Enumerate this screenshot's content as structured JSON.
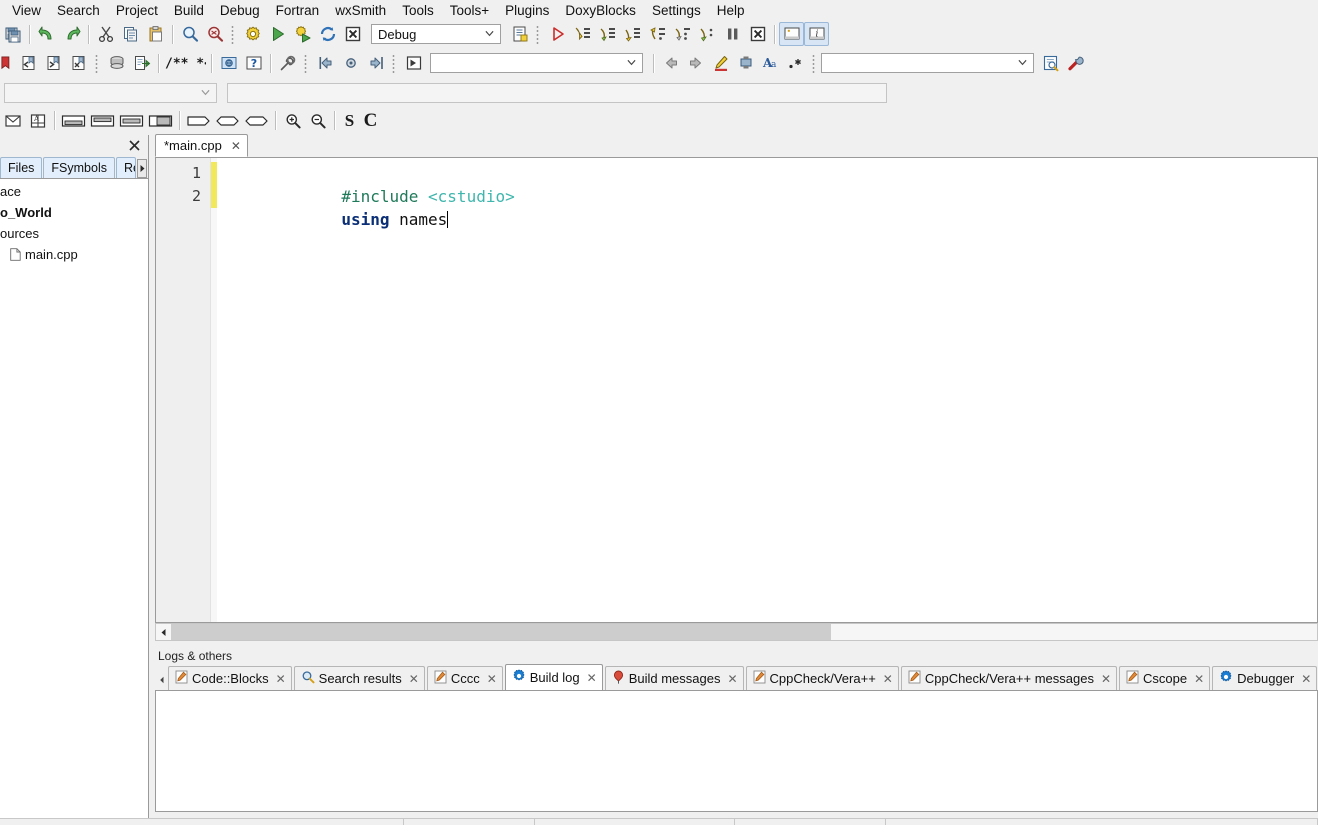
{
  "menu": {
    "items": [
      "View",
      "Search",
      "Project",
      "Build",
      "Debug",
      "Fortran",
      "wxSmith",
      "Tools",
      "Tools+",
      "Plugins",
      "DoxyBlocks",
      "Settings",
      "Help"
    ]
  },
  "toolbar_main": {
    "buttons": [
      {
        "name": "save-all-icon",
        "title": "Save all files"
      },
      {
        "name": "undo-icon",
        "title": "Undo"
      },
      {
        "name": "redo-icon",
        "title": "Redo"
      },
      {
        "name": "cut-icon",
        "title": "Cut"
      },
      {
        "name": "copy-icon",
        "title": "Copy"
      },
      {
        "name": "paste-icon",
        "title": "Paste"
      },
      {
        "name": "find-icon",
        "title": "Find"
      },
      {
        "name": "replace-icon",
        "title": "Replace"
      }
    ]
  },
  "toolbar_compile": {
    "buttons": [
      {
        "name": "build-icon",
        "title": "Build"
      },
      {
        "name": "run-icon",
        "title": "Run"
      },
      {
        "name": "build-and-run-icon",
        "title": "Build and run"
      },
      {
        "name": "rebuild-icon",
        "title": "Rebuild"
      },
      {
        "name": "abort-icon",
        "title": "Abort"
      }
    ],
    "target_value": "Debug",
    "target_options": [
      "Debug",
      "Release"
    ]
  },
  "toolbar_debug": {
    "buttons": [
      {
        "name": "debug-continue-icon",
        "title": "Debug / Continue"
      },
      {
        "name": "debug-run-to-cursor-icon",
        "title": "Run to cursor"
      },
      {
        "name": "debug-next-line-icon",
        "title": "Next line"
      },
      {
        "name": "debug-step-into-icon",
        "title": "Step into"
      },
      {
        "name": "debug-step-out-icon",
        "title": "Step out"
      },
      {
        "name": "debug-next-instruction-icon",
        "title": "Next instruction"
      },
      {
        "name": "debug-step-into-instruction-icon",
        "title": "Step into instruction"
      },
      {
        "name": "debug-break-icon",
        "title": "Break debugger"
      },
      {
        "name": "debug-stop-icon",
        "title": "Stop debugger"
      },
      {
        "name": "debug-windows-icon",
        "title": "Debugging windows"
      },
      {
        "name": "debug-info-icon",
        "title": "Various info"
      }
    ]
  },
  "toolbar_row2": {
    "buttons": [
      {
        "name": "bookmark-toggle-icon",
        "title": "Toggle bookmark"
      },
      {
        "name": "bookmark-prev-icon",
        "title": "Previous bookmark"
      },
      {
        "name": "bookmark-next-icon",
        "title": "Next bookmark"
      },
      {
        "name": "bookmark-clear-icon",
        "title": "Clear all bookmarks"
      },
      {
        "name": "doxyblocks-run-icon",
        "title": "DoxyBlocks run"
      },
      {
        "name": "doxyblocks-extract-icon",
        "title": "Extract documentation"
      },
      {
        "name": "doxyblocks-comment-icon",
        "title": "Block comment"
      },
      {
        "name": "doxyblocks-html-icon",
        "title": "Open HTML docs"
      },
      {
        "name": "doxyblocks-help-icon",
        "title": "Help"
      },
      {
        "name": "doxyblocks-config-icon",
        "title": "Configure"
      },
      {
        "name": "nav-back-icon",
        "title": "Back"
      },
      {
        "name": "nav-home-icon",
        "title": "Home"
      },
      {
        "name": "nav-forward-icon",
        "title": "Forward"
      },
      {
        "name": "browse-tracker-icon",
        "title": "Browse tracker"
      }
    ],
    "symbols_value": "",
    "symbols_placeholder": "",
    "incsearch_back_icon": "arrow-left-icon",
    "incsearch_fwd_icon": "arrow-right-icon",
    "highlight_icon": "highlight-icon",
    "selected_only_icon": "selected-only-icon",
    "match_case_icon": "match-case-icon",
    "regex_icon": "regex-icon",
    "search_value": "",
    "search_placeholder": "",
    "thread_search_icon": "thread-search-icon",
    "thread_options_icon": "wrench-icon"
  },
  "toolbar_row3": {
    "combo_value": "",
    "combo_placeholder": ""
  },
  "toolbar_wxsmith": {
    "buttons": [
      {
        "name": "wxsmith-preview-icon",
        "title": "Preview"
      },
      {
        "name": "wxsmith-grid-icon",
        "title": "Grid"
      },
      {
        "name": "wxsmith-layout-top-icon",
        "title": "Layout top"
      },
      {
        "name": "wxsmith-layout-mid-icon",
        "title": "Layout middle"
      },
      {
        "name": "wxsmith-layout-center-icon",
        "title": "Layout center"
      },
      {
        "name": "wxsmith-layout-fill-icon",
        "title": "Layout fill"
      },
      {
        "name": "wxsmith-shape1-icon",
        "title": "Expand left"
      },
      {
        "name": "wxsmith-shape2-icon",
        "title": "Expand both"
      },
      {
        "name": "wxsmith-shape3-icon",
        "title": "Expand right"
      },
      {
        "name": "wxsmith-zoom-in-icon",
        "title": "Zoom in"
      },
      {
        "name": "wxsmith-zoom-out-icon",
        "title": "Zoom out"
      }
    ],
    "letter_s": "S",
    "letter_c": "C"
  },
  "sidebar": {
    "close_icon": "close-icon",
    "tabs": [
      {
        "label": "Files",
        "active": false
      },
      {
        "label": "FSymbols",
        "active": false
      },
      {
        "label": "Re",
        "active": false
      }
    ],
    "tab_overflow_icon": "chevron-right-icon",
    "tree": [
      {
        "label": "ace",
        "bold": false,
        "icon": false
      },
      {
        "label": "o_World",
        "bold": true,
        "icon": false
      },
      {
        "label": "ources",
        "bold": false,
        "icon": false
      },
      {
        "label": "main.cpp",
        "bold": false,
        "icon": true
      }
    ]
  },
  "editor": {
    "tab_label": "*main.cpp",
    "tab_close": "✕",
    "lines": [
      {
        "number": "1",
        "changed": true,
        "tokens": [
          {
            "text": "#include",
            "cls": "tok-pre"
          },
          {
            "text": " ",
            "cls": "tok-id"
          },
          {
            "text": "<cstudio>",
            "cls": "tok-inc"
          }
        ]
      },
      {
        "number": "2",
        "changed": true,
        "tokens": [
          {
            "text": "using",
            "cls": "tok-kw"
          },
          {
            "text": " ",
            "cls": "tok-id"
          },
          {
            "text": "names",
            "cls": "tok-id"
          }
        ],
        "caret": true
      }
    ],
    "hscroll_left_icon": "chevron-left-icon"
  },
  "logs": {
    "title": "Logs & others",
    "scroll_left_icon": "chevron-left-icon",
    "tabs": [
      {
        "label": "Code::Blocks",
        "icon": "notepad-icon",
        "active": false
      },
      {
        "label": "Search results",
        "icon": "magnifier-icon",
        "active": false
      },
      {
        "label": "Cccc",
        "icon": "notepad-icon",
        "active": false
      },
      {
        "label": "Build log",
        "icon": "gear-icon",
        "active": true
      },
      {
        "label": "Build messages",
        "icon": "balloon-icon",
        "active": false
      },
      {
        "label": "CppCheck/Vera++",
        "icon": "notepad-icon",
        "active": false
      },
      {
        "label": "CppCheck/Vera++ messages",
        "icon": "notepad-icon",
        "active": false
      },
      {
        "label": "Cscope",
        "icon": "notepad-icon",
        "active": false
      },
      {
        "label": "Debugger",
        "icon": "gear-icon",
        "active": false
      }
    ],
    "tab_close": "✕",
    "content": ""
  },
  "colors": {
    "window_bg": "#f0f0f0",
    "editor_bg": "#ffffff",
    "gutter_bg": "#efefef",
    "change_marker": "#f2e85c",
    "preprocessor": "#1f7a5a",
    "include_string": "#3fb6ad",
    "keyword": "#0b2f77",
    "tab_active_bg": "#ffffff",
    "tab_inactive_bg": "#e2eefb",
    "accent_blue": "#1a7fd4"
  }
}
